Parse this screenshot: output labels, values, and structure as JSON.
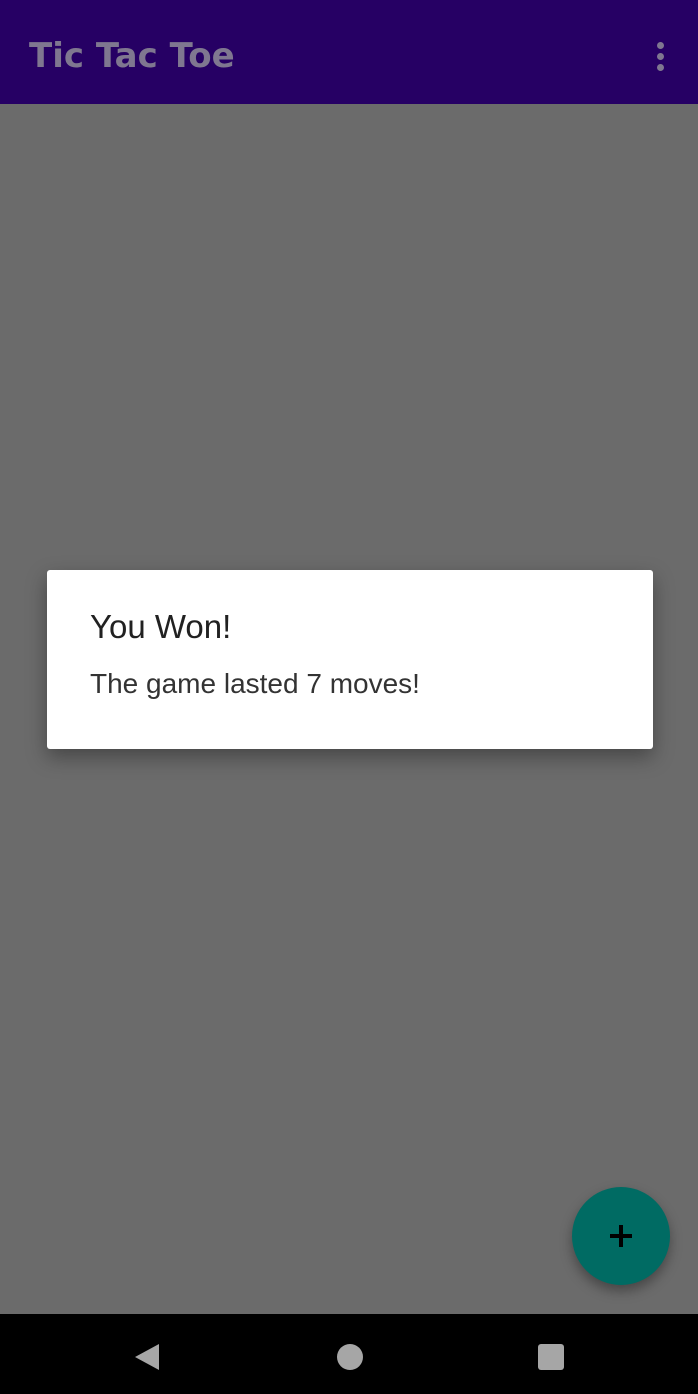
{
  "app": {
    "title": "Tic Tac Toe",
    "colors": {
      "toolbar": "#260064",
      "scrim_background": "#6b6b6b",
      "fab": "#006b63",
      "dialog_background": "#ffffff",
      "nav_bar": "#000000"
    }
  },
  "toolbar": {
    "overflow_icon": "more-vert-icon"
  },
  "dialog": {
    "title": "You Won!",
    "message": "The game lasted 7 moves!"
  },
  "fab": {
    "icon": "plus-icon"
  },
  "navigation": {
    "back_icon": "back-triangle-icon",
    "home_icon": "home-circle-icon",
    "recents_icon": "recents-square-icon"
  }
}
